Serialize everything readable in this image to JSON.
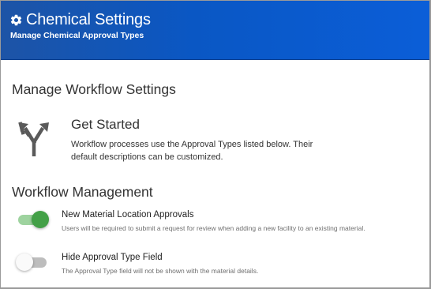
{
  "header": {
    "title": "Chemical Settings",
    "subtitle": "Manage Chemical Approval Types",
    "icon": "gear-icon"
  },
  "workflow_settings": {
    "title": "Manage Workflow Settings",
    "get_started": {
      "icon": "split-arrows-icon",
      "title": "Get Started",
      "text": "Workflow processes use the Approval Types listed below. Their default descriptions can be customized."
    }
  },
  "workflow_management": {
    "title": "Workflow Management",
    "options": [
      {
        "label": "New Material Location Approvals",
        "description": "Users will be required to submit a request for review when adding a new facility to an existing material.",
        "enabled": true
      },
      {
        "label": "Hide Approval Type Field",
        "description": "The Approval Type field will not be shown with the material details.",
        "enabled": false
      }
    ]
  },
  "colors": {
    "header_blue": "#0a57c4",
    "toggle_on": "#43a047",
    "toggle_off": "#bdbdbd"
  }
}
